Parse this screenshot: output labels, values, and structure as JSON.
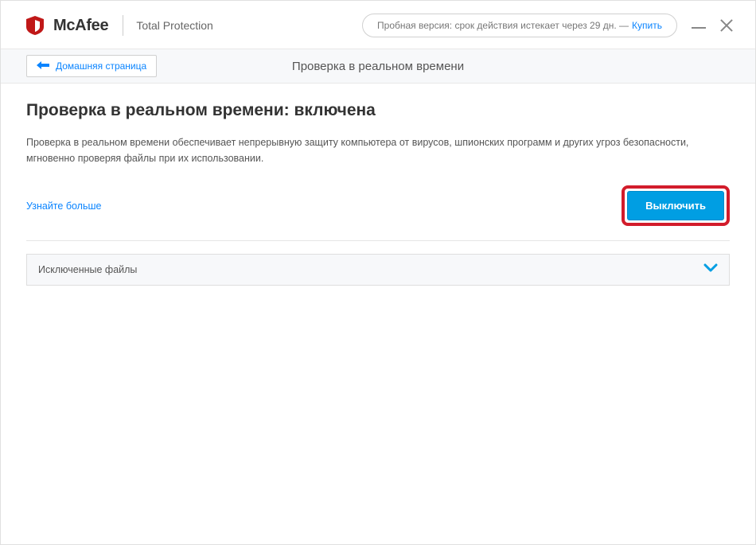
{
  "brand": {
    "name": "McAfee",
    "product": "Total Protection"
  },
  "trial": {
    "text": "Пробная версия: срок действия истекает через 29 дн. —",
    "buy_label": "Купить"
  },
  "subheader": {
    "back_label": "Домашняя страница",
    "title": "Проверка в реальном времени"
  },
  "main": {
    "heading": "Проверка в реальном времени: включена",
    "description": "Проверка в реальном времени обеспечивает непрерывную защиту компьютера от вирусов, шпионских программ и других угроз безопасности, мгновенно проверяя файлы при их использовании.",
    "learn_more": "Узнайте больше",
    "toggle_button": "Выключить"
  },
  "panel": {
    "excluded_files": "Исключенные файлы"
  }
}
